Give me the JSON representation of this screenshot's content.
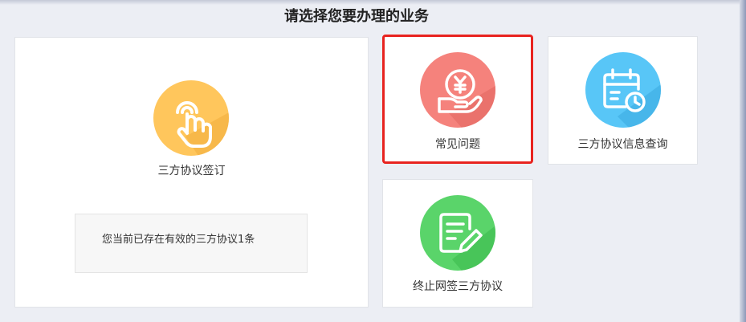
{
  "page": {
    "title": "请选择您要办理的业务"
  },
  "services": {
    "sign": {
      "label": "三方协议签订",
      "icon": "hand-pointer-icon",
      "color": "#ffc65c"
    },
    "faq": {
      "label": "常见问题",
      "icon": "yuan-hand-icon",
      "color": "#f5827c"
    },
    "query": {
      "label": "三方协议信息查询",
      "icon": "calendar-clock-icon",
      "color": "#58c6f7"
    },
    "terminate": {
      "label": "终止网签三方协议",
      "icon": "document-edit-icon",
      "color": "#5ad46a"
    }
  },
  "notice": {
    "text": "您当前已存在有效的三方协议1条"
  },
  "selection": {
    "highlight_color": "#e8231f"
  }
}
